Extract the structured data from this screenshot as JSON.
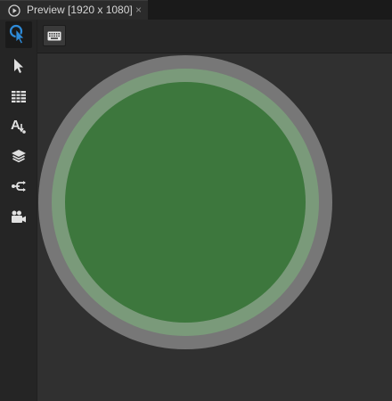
{
  "tab": {
    "title": "Preview [1920 x 1080]",
    "close_glyph": "×",
    "icon": "play-circle-icon"
  },
  "left_toolbar": {
    "tools": [
      {
        "icon": "interact-cursor-icon",
        "active": true
      },
      {
        "icon": "select-arrow-icon",
        "active": false
      },
      {
        "icon": "grid-table-icon",
        "active": false
      },
      {
        "icon": "text-tool-icon",
        "active": false
      },
      {
        "icon": "layers-icon",
        "active": false
      },
      {
        "icon": "connector-icon",
        "active": false
      },
      {
        "icon": "video-camera-icon",
        "active": false
      }
    ]
  },
  "top_toolbar": {
    "keyboard_icon": "keyboard-icon"
  },
  "canvas": {
    "button_colors": {
      "outer_ring": "#777777",
      "mid_ring": "#7a9a7a",
      "fill": "#3d773d"
    }
  },
  "colors": {
    "accent": "#2e8bd9",
    "background": "#303030"
  }
}
